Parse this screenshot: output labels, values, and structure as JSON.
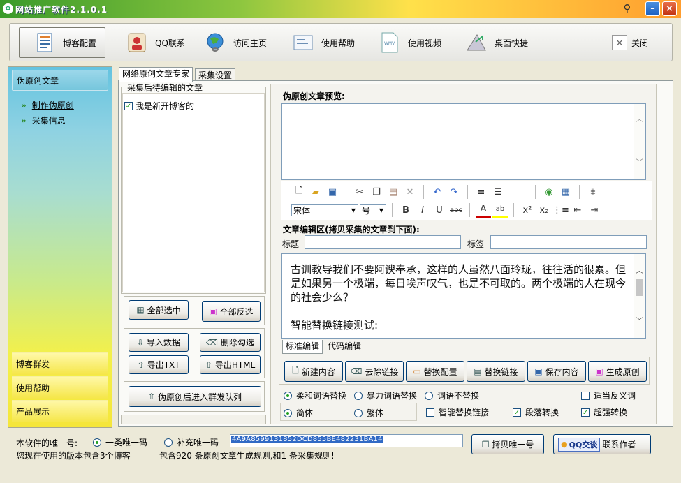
{
  "window": {
    "title": "网站推广软件2.1.0.1"
  },
  "toolbar": {
    "items": [
      {
        "label": "博客配置",
        "icon": "document-icon"
      },
      {
        "label": "QQ联系",
        "icon": "person-icon"
      },
      {
        "label": "访问主页",
        "icon": "globe-icon"
      },
      {
        "label": "使用帮助",
        "icon": "help-doc-icon"
      },
      {
        "label": "使用视频",
        "icon": "video-icon"
      },
      {
        "label": "桌面快捷",
        "icon": "shortcut-icon"
      }
    ],
    "close_label": "关闭"
  },
  "sidebar": {
    "header": "伪原创文章",
    "items": [
      {
        "label": "制作伪原创",
        "active": true
      },
      {
        "label": "采集信息",
        "active": false
      }
    ],
    "sections": [
      "博客群发",
      "使用帮助",
      "产品展示"
    ]
  },
  "tabs": [
    "网络原创文章专家",
    "采集设置"
  ],
  "left_panel": {
    "group_title": "采集后待编辑的文章",
    "list": [
      {
        "label": "我是新开博客的",
        "checked": true
      }
    ],
    "buttons": {
      "select_all": "全部选中",
      "invert": "全部反选",
      "import": "导入数据",
      "delete_checked": "删除勾选",
      "export_txt": "导出TXT",
      "export_html": "导出HTML",
      "queue": "伪原创后进入群发队列"
    }
  },
  "right_panel": {
    "preview_label": "伪原创文章预览:",
    "editor": {
      "font": "宋体",
      "size": "号"
    },
    "edit_label": "文章编辑区(拷贝采集的文章到下面):",
    "title_label": "标题",
    "title_value": "",
    "tag_label": "标签",
    "tag_value": "",
    "content": "古训教导我们不要阿谀奉承，这样的人虽然八面玲珑，往往活的很累。但是如果另一个极端，每日唉声叹气，也是不可取的。两个极端的人在现今的社会少么？",
    "content2": "智能替换链接测试:",
    "subtabs": [
      "标准编辑",
      "代码编辑"
    ],
    "action_buttons": {
      "new": "新建内容",
      "remove_links": "去除链接",
      "replace_config": "替换配置",
      "replace_links": "替换链接",
      "save": "保存内容",
      "generate": "生成原创"
    },
    "options": {
      "soft": "柔和词语替换",
      "brute": "暴力词语替换",
      "none": "词语不替换",
      "antonym": "适当反义词",
      "simplified": "简体",
      "traditional": "繁体",
      "smart_links": "智能替换链接",
      "paragraph": "段落转换",
      "super": "超强转换"
    }
  },
  "footer": {
    "unique_label": "本软件的唯一号:",
    "radio1": "一类唯一码",
    "radio2": "补充唯一码",
    "uid": "4A9A8599131852DCD855BE482231BA14",
    "copy_btn": "拷贝唯一号",
    "qq_btn": "QQ交谈",
    "contact": "联系作者",
    "version_info": "您现在使用的版本包含3个博客",
    "rules_info": "包含920 条原创文章生成规则,和1 条采集规则!"
  }
}
